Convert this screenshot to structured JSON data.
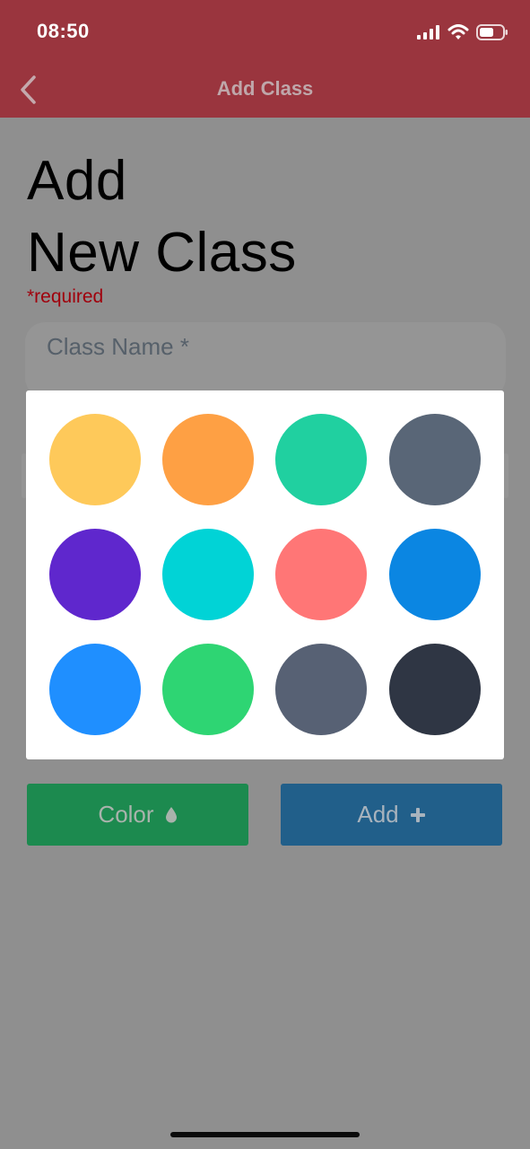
{
  "status_bar": {
    "time": "08:50",
    "icons": [
      "signal-icon",
      "wifi-icon",
      "battery-icon"
    ]
  },
  "nav": {
    "back_icon": "chevron-left-icon",
    "title": "Add Class"
  },
  "page": {
    "title_line1": "Add",
    "title_line2": "New Class",
    "required_note": "*required"
  },
  "form": {
    "class_name_placeholder": "Class Name *",
    "class_name_value": ""
  },
  "color_picker": {
    "swatches": [
      "#fec95a",
      "#fea044",
      "#20d0a0",
      "#596677",
      "#5f27cd",
      "#01d3d6",
      "#ff7676",
      "#0b86e2",
      "#1f8fff",
      "#2ed573",
      "#576174",
      "#2f3644"
    ]
  },
  "actions": {
    "color_label": "Color",
    "color_icon": "droplet-icon",
    "add_label": "Add",
    "add_icon": "plus-icon"
  },
  "colors": {
    "header": "#9a353e",
    "overlay": "#8f8f8f",
    "color_button": "#1c8a4f",
    "add_button": "#215f8a",
    "required_text": "#a0000c"
  }
}
